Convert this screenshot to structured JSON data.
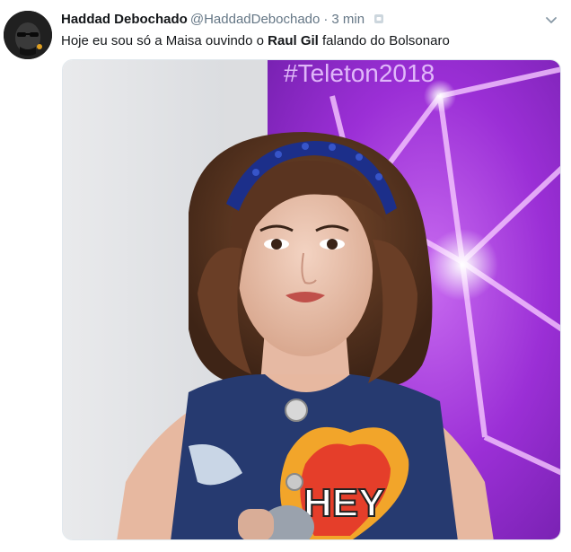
{
  "tweet": {
    "display_name": "Haddad Debochado",
    "handle": "@HaddadDebochado",
    "separator": "·",
    "time": "3 min",
    "text_before": "Hoje eu sou só a Maisa ouvindo o ",
    "text_bold": "Raul Gil",
    "text_after": " falando do Bolsonaro",
    "media": {
      "overlay_text": "#Teleton2018",
      "shirt_text": "HEY"
    },
    "icons": {
      "caret": "chevron-down-icon",
      "badge": "protected-badge-icon"
    }
  },
  "colors": {
    "name": "#14171a",
    "secondary": "#657786",
    "purple_bg": "#9b2fd6",
    "headband": "#1c2f8a"
  }
}
